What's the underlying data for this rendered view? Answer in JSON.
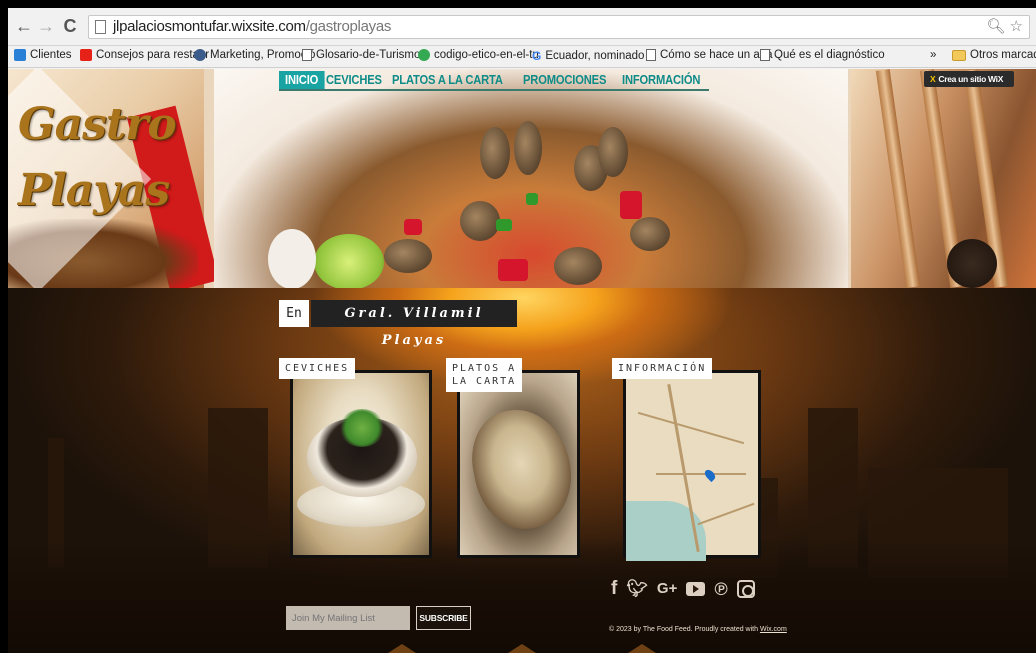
{
  "browser": {
    "back_icon": "arrow-left",
    "forward_icon": "arrow-right",
    "reload_icon": "reload",
    "url_host": "jlpalaciosmontufar.wixsite.com",
    "url_path": "/gastroplayas",
    "right_icons": "zoom-star"
  },
  "bookmarks": {
    "items": [
      {
        "label": "Clientes",
        "icon": "m-logo",
        "color": "#2a80d6"
      },
      {
        "label": "Consejos para restaur",
        "icon": "youtube",
        "color": "#e62117"
      },
      {
        "label": "Marketing, Promoció",
        "icon": "globe",
        "color": "#3b5b8a"
      },
      {
        "label": "Glosario-de-Turismo-",
        "icon": "page",
        "color": "#ffffff"
      },
      {
        "label": "codigo-etico-en-el-tu",
        "icon": "green-circle",
        "color": "#34a853"
      },
      {
        "label": "Ecuador, nominado a",
        "icon": "google-g",
        "color": "#4285f4"
      },
      {
        "label": "Cómo se hace un aná",
        "icon": "page",
        "color": "#ffffff"
      },
      {
        "label": "Qué es el diagnóstico",
        "icon": "page",
        "color": "#ffffff"
      }
    ],
    "more": "»",
    "other": "Otros marcado"
  },
  "site": {
    "logo_line1": "Gastro",
    "logo_line2": "Playas",
    "nav": [
      {
        "label": "INICIO",
        "active": true
      },
      {
        "label": "CEVICHES",
        "active": false
      },
      {
        "label": "PLATOS A LA CARTA",
        "active": false
      },
      {
        "label": "PROMOCIONES",
        "active": false
      },
      {
        "label": "INFORMACIÓN",
        "active": false
      }
    ],
    "wix_banner": "Crea un sitio WiX",
    "lang": "En",
    "place": "Gral. Villamil Playas",
    "cards": [
      {
        "label": "CEVICHES"
      },
      {
        "label_line1": "PLATOS A",
        "label_line2": "LA CARTA"
      },
      {
        "label": "INFORMACIÓN"
      }
    ],
    "social": [
      "f",
      "twitter",
      "G+",
      "youtube",
      "pinterest",
      "instagram"
    ],
    "mailing_placeholder": "Join My Mailing List",
    "subscribe": "SUBSCRIBE",
    "copyright_prefix": "© 2023 by The Food Feed. Proudly created with ",
    "copyright_link": "Wix.com"
  }
}
